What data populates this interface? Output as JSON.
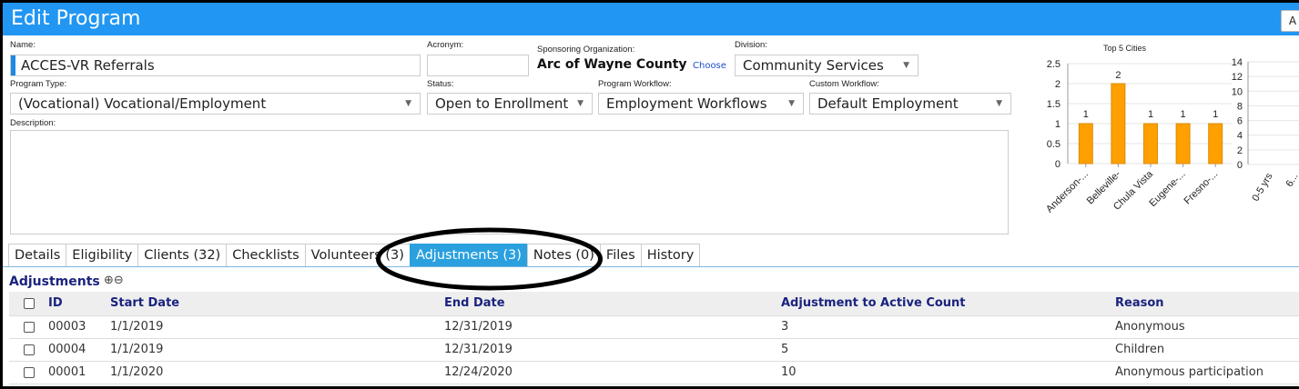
{
  "window": {
    "title": "Edit Program",
    "corner_button": "A"
  },
  "form": {
    "name_label": "Name:",
    "name_value": "ACCES-VR Referrals",
    "acronym_label": "Acronym:",
    "acronym_value": "",
    "sponsor_label": "Sponsoring Organization:",
    "sponsor_value": "Arc of Wayne County",
    "choose_link": "Choose",
    "division_label": "Division:",
    "division_value": "Community Services",
    "program_type_label": "Program Type:",
    "program_type_value": "(Vocational) Vocational/Employment",
    "status_label": "Status:",
    "status_value": "Open to Enrollment",
    "program_workflow_label": "Program Workflow:",
    "program_workflow_value": "Employment Workflows",
    "custom_workflow_label": "Custom Workflow:",
    "custom_workflow_value": "Default Employment",
    "description_label": "Description:",
    "description_value": ""
  },
  "tabs": [
    {
      "label": "Details"
    },
    {
      "label": "Eligibility"
    },
    {
      "label": "Clients (32)"
    },
    {
      "label": "Checklists"
    },
    {
      "label": "Volunteers (3)"
    },
    {
      "label": "Adjustments (3)",
      "active": true
    },
    {
      "label": "Notes (0)"
    },
    {
      "label": "Files"
    },
    {
      "label": "History"
    }
  ],
  "adjustments": {
    "title": "Adjustments",
    "add_icon": "plus-circle-icon",
    "remove_icon": "minus-circle-icon",
    "columns": [
      "ID",
      "Start Date",
      "End Date",
      "Adjustment to Active Count",
      "Reason"
    ],
    "rows": [
      {
        "id": "00003",
        "start": "1/1/2019",
        "end": "12/31/2019",
        "adjustment": "3",
        "reason": "Anonymous"
      },
      {
        "id": "00004",
        "start": "1/1/2019",
        "end": "12/31/2019",
        "adjustment": "5",
        "reason": "Children"
      },
      {
        "id": "00001",
        "start": "1/1/2020",
        "end": "12/24/2020",
        "adjustment": "10",
        "reason": "Anonymous participation"
      }
    ]
  },
  "colors": {
    "accent": "#2196f3",
    "tab_active": "#2aa0de",
    "bar": "#ffa000",
    "header_text": "#1a237e"
  },
  "chart_data": [
    {
      "type": "bar",
      "title": "Top 5 Cities",
      "categories": [
        "Anderson-...",
        "Belleville-",
        "Chula Vista",
        "Eugene-...",
        "Fresno-..."
      ],
      "values": [
        1,
        2,
        1,
        1,
        1
      ],
      "data_labels": [
        "1",
        "2",
        "1",
        "1",
        "1"
      ],
      "yticks": [
        "0",
        "0.5",
        "1",
        "1.5",
        "2",
        "2.5"
      ],
      "ylim": [
        0,
        2.5
      ],
      "grid": true
    },
    {
      "type": "bar",
      "title": "",
      "categories": [
        "0-5 yrs",
        "6..."
      ],
      "values": [],
      "yticks": [
        "0",
        "2",
        "4",
        "6",
        "8",
        "10",
        "12",
        "14"
      ],
      "ylim": [
        0,
        14
      ],
      "grid": true
    }
  ]
}
